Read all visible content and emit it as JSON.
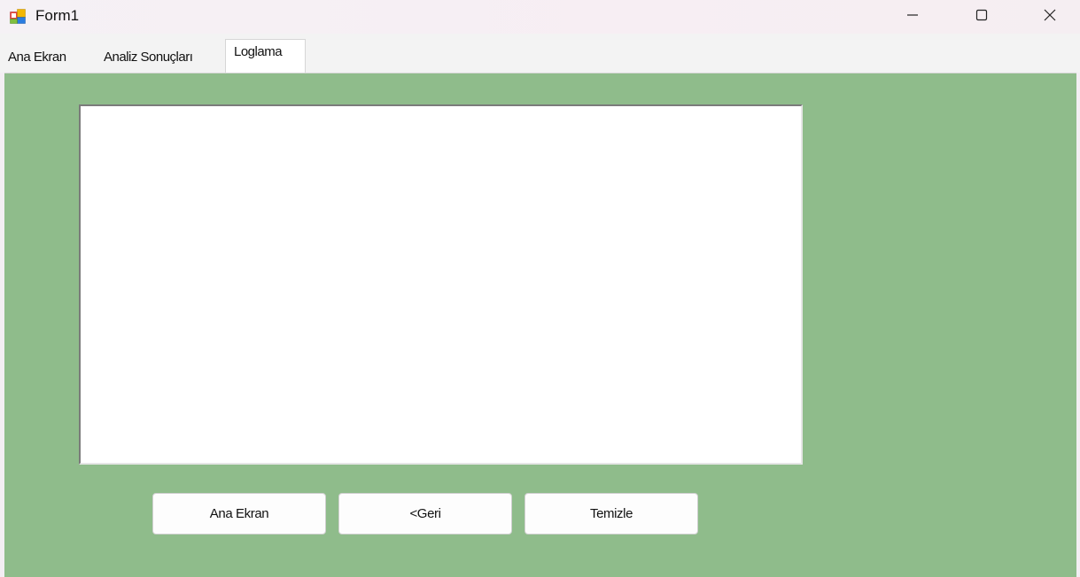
{
  "window": {
    "title": "Form1",
    "icon": "winforms-app-icon",
    "controls": {
      "minimize_icon": "minimize-icon",
      "maximize_icon": "maximize-icon",
      "close_icon": "close-icon"
    }
  },
  "tabs": [
    {
      "label": "Ana Ekran",
      "selected": false
    },
    {
      "label": "Analiz Sonuçları",
      "selected": false
    },
    {
      "label": "Loglama",
      "selected": true
    }
  ],
  "log_panel": {
    "background_color": "#8fbc8b",
    "log_text": ""
  },
  "buttons": {
    "ana_ekran": "Ana Ekran",
    "geri": "<Geri",
    "temizle": "Temizle"
  }
}
